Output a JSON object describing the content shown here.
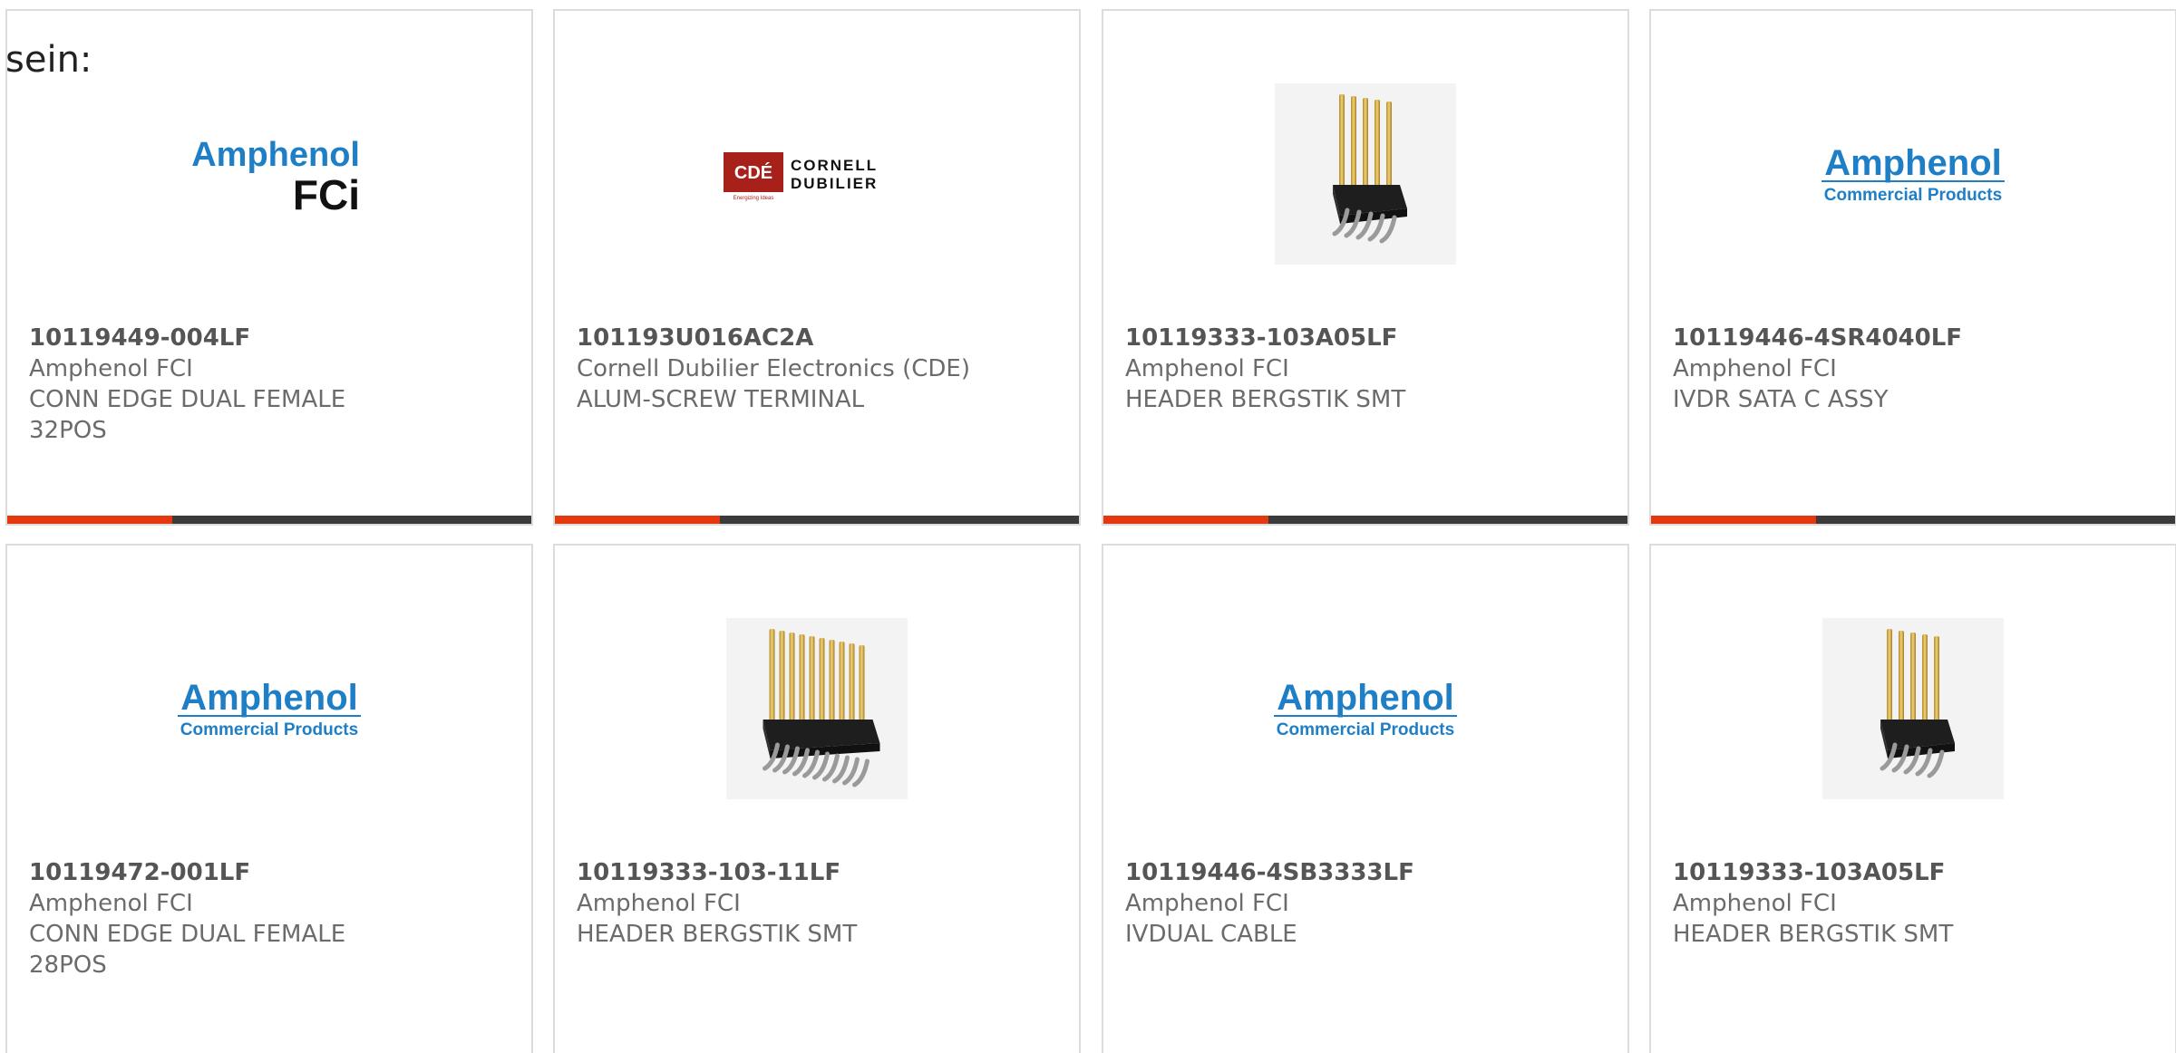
{
  "intro_text": "sein:",
  "colors": {
    "accent": "#e5380f",
    "bar": "#3b3b3b",
    "amphenol_blue": "#1f7fc6",
    "cde_red": "#a8201a"
  },
  "products": [
    {
      "part_number": "10119449-004LF",
      "manufacturer": "Amphenol FCI",
      "description": "CONN EDGE DUAL FEMALE 32POS",
      "image": "amphenol-fci-logo",
      "logo": {
        "line1": "Amphenol",
        "line2": "FCi"
      }
    },
    {
      "part_number": "101193U016AC2A",
      "manufacturer": "Cornell Dubilier Electronics (CDE)",
      "description": "ALUM-SCREW TERMINAL",
      "image": "cornell-dubilier-logo",
      "logo": {
        "mark": "CDÉ",
        "line1": "CORNELL",
        "line2": "DUBILIER",
        "tagline": "Energizing Ideas"
      }
    },
    {
      "part_number": "10119333-103A05LF",
      "manufacturer": "Amphenol FCI",
      "description": "HEADER BERGSTIK SMT",
      "image": "pin-header-5-image"
    },
    {
      "part_number": "10119446-4SR4040LF",
      "manufacturer": "Amphenol FCI",
      "description": "IVDR SATA C ASSY",
      "image": "amphenol-commercial-logo",
      "logo": {
        "line1": "Amphenol",
        "line2": "Commercial Products"
      }
    },
    {
      "part_number": "10119472-001LF",
      "manufacturer": "Amphenol FCI",
      "description": "CONN EDGE DUAL FEMALE 28POS",
      "image": "amphenol-commercial-logo",
      "logo": {
        "line1": "Amphenol",
        "line2": "Commercial Products"
      }
    },
    {
      "part_number": "10119333-103-11LF",
      "manufacturer": "Amphenol FCI",
      "description": "HEADER BERGSTIK SMT",
      "image": "pin-header-10-image"
    },
    {
      "part_number": "10119446-4SB3333LF",
      "manufacturer": "Amphenol FCI",
      "description": "IVDUAL CABLE",
      "image": "amphenol-commercial-logo",
      "logo": {
        "line1": "Amphenol",
        "line2": "Commercial Products"
      }
    },
    {
      "part_number": "10119333-103A05LF",
      "manufacturer": "Amphenol FCI",
      "description": "HEADER BERGSTIK SMT",
      "image": "pin-header-5-image"
    }
  ]
}
